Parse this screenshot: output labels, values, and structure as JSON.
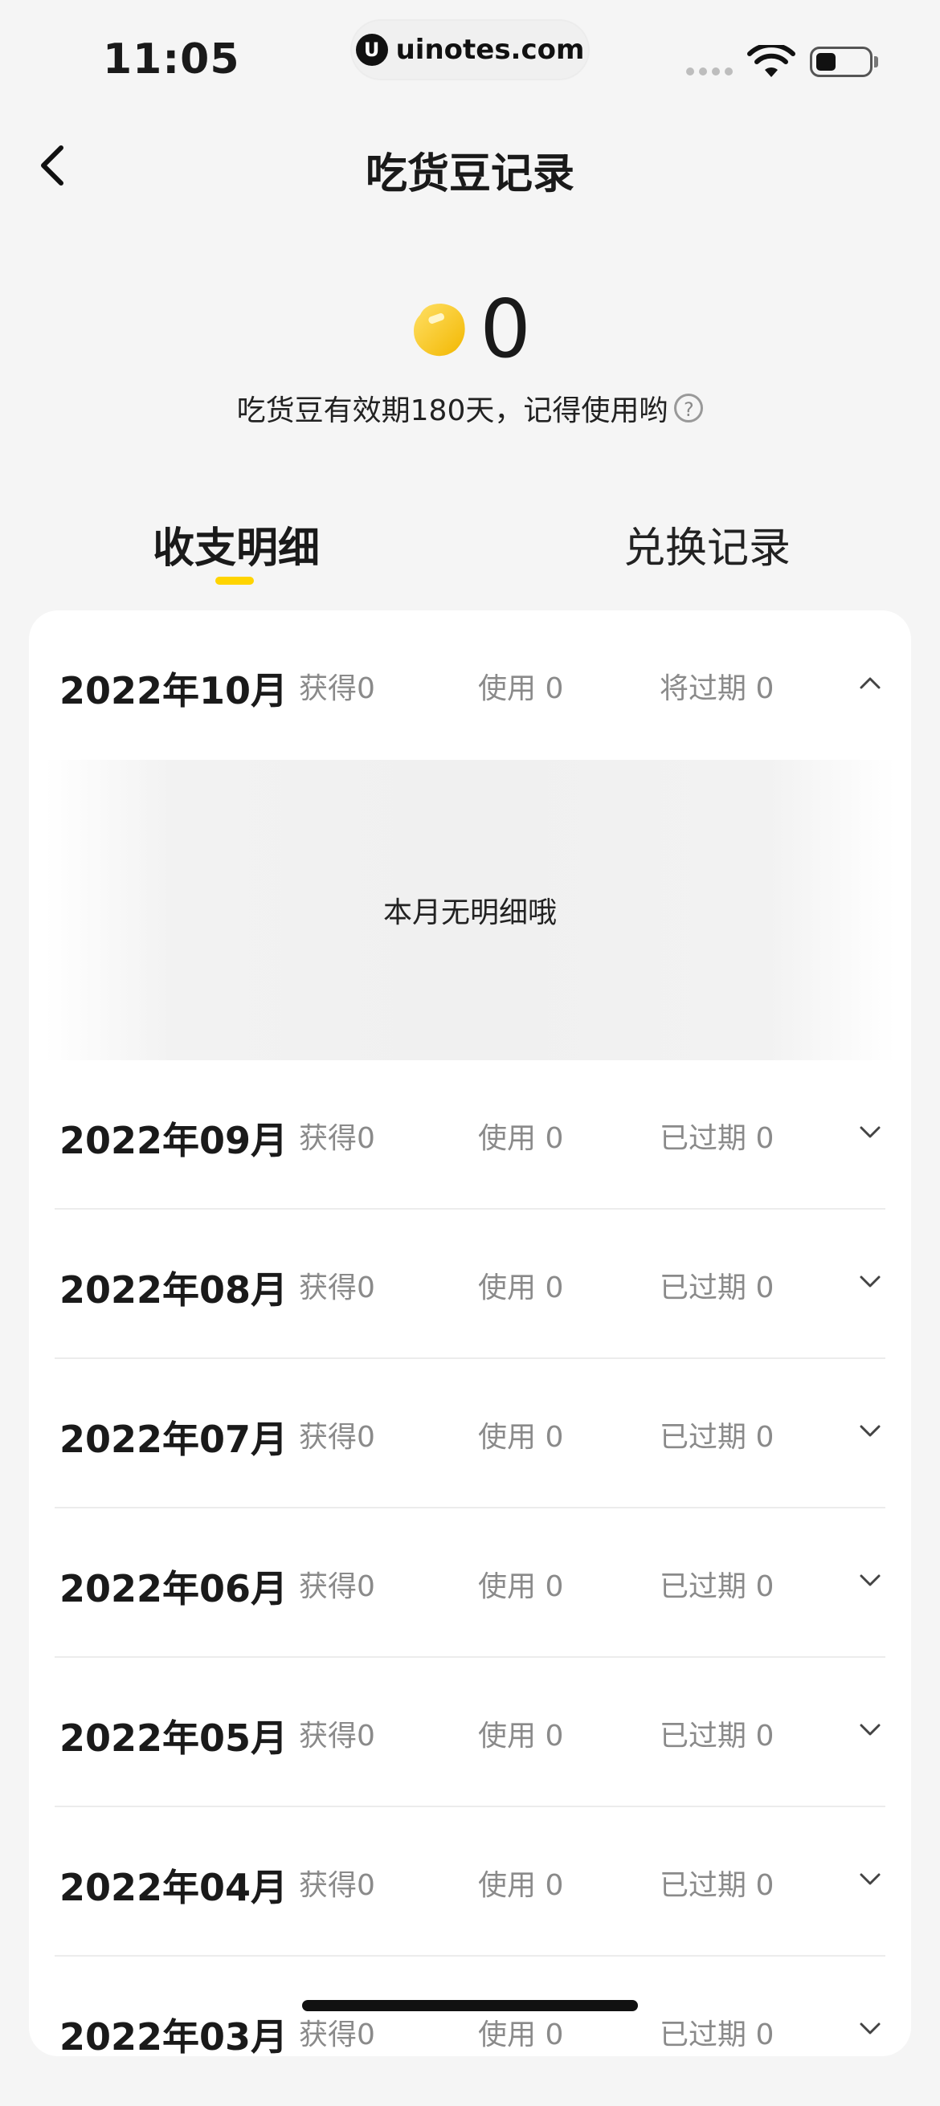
{
  "status_bar": {
    "time": "11:05",
    "url": "uinotes.com",
    "url_logo_letter": "U"
  },
  "nav": {
    "title": "吃货豆记录"
  },
  "balance": {
    "value": "0",
    "validity_text": "吃货豆有效期180天，记得使用哟",
    "help_symbol": "?"
  },
  "tabs": [
    {
      "label": "收支明细",
      "active": true
    },
    {
      "label": "兑换记录",
      "active": false
    }
  ],
  "records": [
    {
      "month": "2022年10月",
      "earn": "获得0",
      "use": "使用 0",
      "expire": "将过期 0",
      "expanded": true
    },
    {
      "month": "2022年09月",
      "earn": "获得0",
      "use": "使用 0",
      "expire": "已过期 0",
      "expanded": false
    },
    {
      "month": "2022年08月",
      "earn": "获得0",
      "use": "使用 0",
      "expire": "已过期 0",
      "expanded": false
    },
    {
      "month": "2022年07月",
      "earn": "获得0",
      "use": "使用 0",
      "expire": "已过期 0",
      "expanded": false
    },
    {
      "month": "2022年06月",
      "earn": "获得0",
      "use": "使用 0",
      "expire": "已过期 0",
      "expanded": false
    },
    {
      "month": "2022年05月",
      "earn": "获得0",
      "use": "使用 0",
      "expire": "已过期 0",
      "expanded": false
    },
    {
      "month": "2022年04月",
      "earn": "获得0",
      "use": "使用 0",
      "expire": "已过期 0",
      "expanded": false
    },
    {
      "month": "2022年03月",
      "earn": "获得0",
      "use": "使用 0",
      "expire": "已过期 0",
      "expanded": false
    }
  ],
  "empty_state": {
    "text": "本月无明细哦"
  },
  "colors": {
    "accent": "#ffd400",
    "bean": "#f7c500",
    "background": "#f5f5f5"
  }
}
